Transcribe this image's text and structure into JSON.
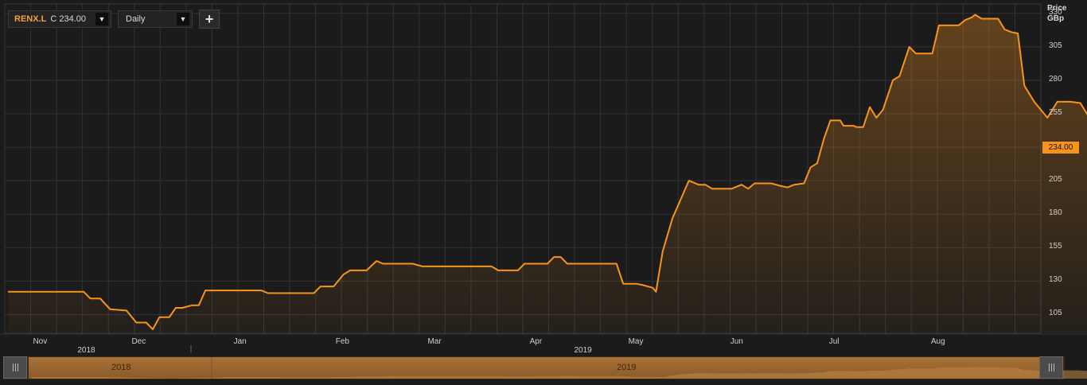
{
  "toolbar": {
    "symbol": "RENX.L",
    "quote": "C 234.00",
    "interval": "Daily",
    "add_label": "+"
  },
  "axis": {
    "unit_line1": "Price",
    "unit_line2": "GBp",
    "last_price_label": "234.00"
  },
  "navigator": {
    "years": [
      "2018",
      "2019"
    ]
  },
  "colors": {
    "line": "#f7931e",
    "background": "#1b1b1b",
    "grid": "#333333",
    "navigator_fill": "#9c6a34"
  },
  "chart_data": {
    "type": "area",
    "ylabel": "Price GBp",
    "yticks": [
      105,
      130,
      155,
      180,
      205,
      230,
      255,
      280,
      305,
      330
    ],
    "ylim": [
      91,
      337
    ],
    "xlim": [
      "2018-10-21",
      "2019-09-01"
    ],
    "x_month_labels": [
      {
        "label": "Nov",
        "date": "2018-11-01"
      },
      {
        "label": "Dec",
        "date": "2018-12-01"
      },
      {
        "label": "Jan",
        "date": "2019-01-01"
      },
      {
        "label": "Feb",
        "date": "2019-02-01"
      },
      {
        "label": "Mar",
        "date": "2019-03-01"
      },
      {
        "label": "Apr",
        "date": "2019-04-01"
      },
      {
        "label": "May",
        "date": "2019-05-01"
      },
      {
        "label": "Jun",
        "date": "2019-06-01"
      },
      {
        "label": "Jul",
        "date": "2019-07-01"
      },
      {
        "label": "Aug",
        "date": "2019-08-01"
      }
    ],
    "x_year_labels": [
      {
        "label": "2018",
        "date": "2018-11-15"
      },
      {
        "label": "2019",
        "date": "2019-04-15"
      }
    ],
    "grid": true,
    "last_value": 234,
    "series": [
      {
        "points": [
          [
            "2018-10-22",
            122
          ],
          [
            "2018-11-14",
            122
          ],
          [
            "2018-11-16",
            117
          ],
          [
            "2018-11-19",
            117
          ],
          [
            "2018-11-22",
            109
          ],
          [
            "2018-11-27",
            108
          ],
          [
            "2018-11-30",
            99
          ],
          [
            "2018-12-03",
            99
          ],
          [
            "2018-12-05",
            94
          ],
          [
            "2018-12-07",
            103
          ],
          [
            "2018-12-10",
            103
          ],
          [
            "2018-12-12",
            110
          ],
          [
            "2018-12-14",
            110
          ],
          [
            "2018-12-17",
            112
          ],
          [
            "2018-12-19",
            112
          ],
          [
            "2018-12-21",
            123
          ],
          [
            "2019-01-07",
            123
          ],
          [
            "2019-01-09",
            121
          ],
          [
            "2019-01-23",
            121
          ],
          [
            "2019-01-25",
            126
          ],
          [
            "2019-01-29",
            126
          ],
          [
            "2019-02-01",
            135
          ],
          [
            "2019-02-03",
            138
          ],
          [
            "2019-02-08",
            138
          ],
          [
            "2019-02-11",
            145
          ],
          [
            "2019-02-13",
            143
          ],
          [
            "2019-02-22",
            143
          ],
          [
            "2019-02-25",
            141
          ],
          [
            "2019-03-18",
            141
          ],
          [
            "2019-03-20",
            138
          ],
          [
            "2019-03-26",
            138
          ],
          [
            "2019-03-28",
            143
          ],
          [
            "2019-04-04",
            143
          ],
          [
            "2019-04-06",
            148
          ],
          [
            "2019-04-08",
            148
          ],
          [
            "2019-04-10",
            143
          ],
          [
            "2019-04-25",
            143
          ],
          [
            "2019-04-27",
            128
          ],
          [
            "2019-05-01",
            128
          ],
          [
            "2019-05-03",
            127
          ],
          [
            "2019-05-06",
            125
          ],
          [
            "2019-05-07",
            122
          ],
          [
            "2019-05-09",
            152
          ],
          [
            "2019-05-12",
            177
          ],
          [
            "2019-05-17",
            205
          ],
          [
            "2019-05-20",
            202
          ],
          [
            "2019-05-22",
            202
          ],
          [
            "2019-05-24",
            199
          ],
          [
            "2019-05-30",
            199
          ],
          [
            "2019-06-02",
            202
          ],
          [
            "2019-06-04",
            199
          ],
          [
            "2019-06-06",
            203
          ],
          [
            "2019-06-11",
            203
          ],
          [
            "2019-06-14",
            201
          ],
          [
            "2019-06-16",
            200
          ],
          [
            "2019-06-18",
            202
          ],
          [
            "2019-06-21",
            203
          ],
          [
            "2019-06-23",
            215
          ],
          [
            "2019-06-25",
            218
          ],
          [
            "2019-06-27",
            236
          ],
          [
            "2019-06-29",
            250
          ],
          [
            "2019-07-02",
            250
          ],
          [
            "2019-07-03",
            246
          ],
          [
            "2019-07-06",
            246
          ],
          [
            "2019-07-07",
            245
          ],
          [
            "2019-07-09",
            245
          ],
          [
            "2019-07-11",
            260
          ],
          [
            "2019-07-13",
            252
          ],
          [
            "2019-07-15",
            258
          ],
          [
            "2019-07-18",
            280
          ],
          [
            "2019-07-20",
            283
          ],
          [
            "2019-07-23",
            305
          ],
          [
            "2019-07-25",
            300
          ],
          [
            "2019-07-30",
            300
          ],
          [
            "2019-08-01",
            321
          ],
          [
            "2019-08-07",
            321
          ],
          [
            "2019-08-09",
            325
          ],
          [
            "2019-08-11",
            327
          ],
          [
            "2019-08-12",
            329
          ],
          [
            "2019-08-14",
            326
          ],
          [
            "2019-08-19",
            326
          ],
          [
            "2019-08-21",
            318
          ],
          [
            "2019-08-23",
            316
          ],
          [
            "2019-08-25",
            315
          ],
          [
            "2019-08-27",
            276
          ],
          [
            "2019-08-30",
            264
          ],
          [
            "2019-09-01",
            258
          ],
          [
            "2019-09-03",
            252
          ],
          [
            "2019-09-06",
            264
          ],
          [
            "2019-09-10",
            264
          ],
          [
            "2019-09-13",
            263
          ],
          [
            "2019-09-16",
            251
          ],
          [
            "2019-09-19",
            251
          ],
          [
            "2019-09-21",
            247
          ],
          [
            "2019-09-23",
            247
          ],
          [
            "2019-09-26",
            240
          ],
          [
            "2019-09-29",
            245
          ],
          [
            "2019-10-08",
            245
          ],
          [
            "2019-10-12",
            240
          ],
          [
            "2019-10-14",
            240
          ],
          [
            "2019-10-17",
            242
          ],
          [
            "2019-10-24",
            242
          ],
          [
            "2019-10-27",
            243
          ],
          [
            "2019-11-01",
            243
          ],
          [
            "2019-11-04",
            243
          ],
          [
            "2019-11-06",
            234
          ]
        ]
      }
    ]
  }
}
